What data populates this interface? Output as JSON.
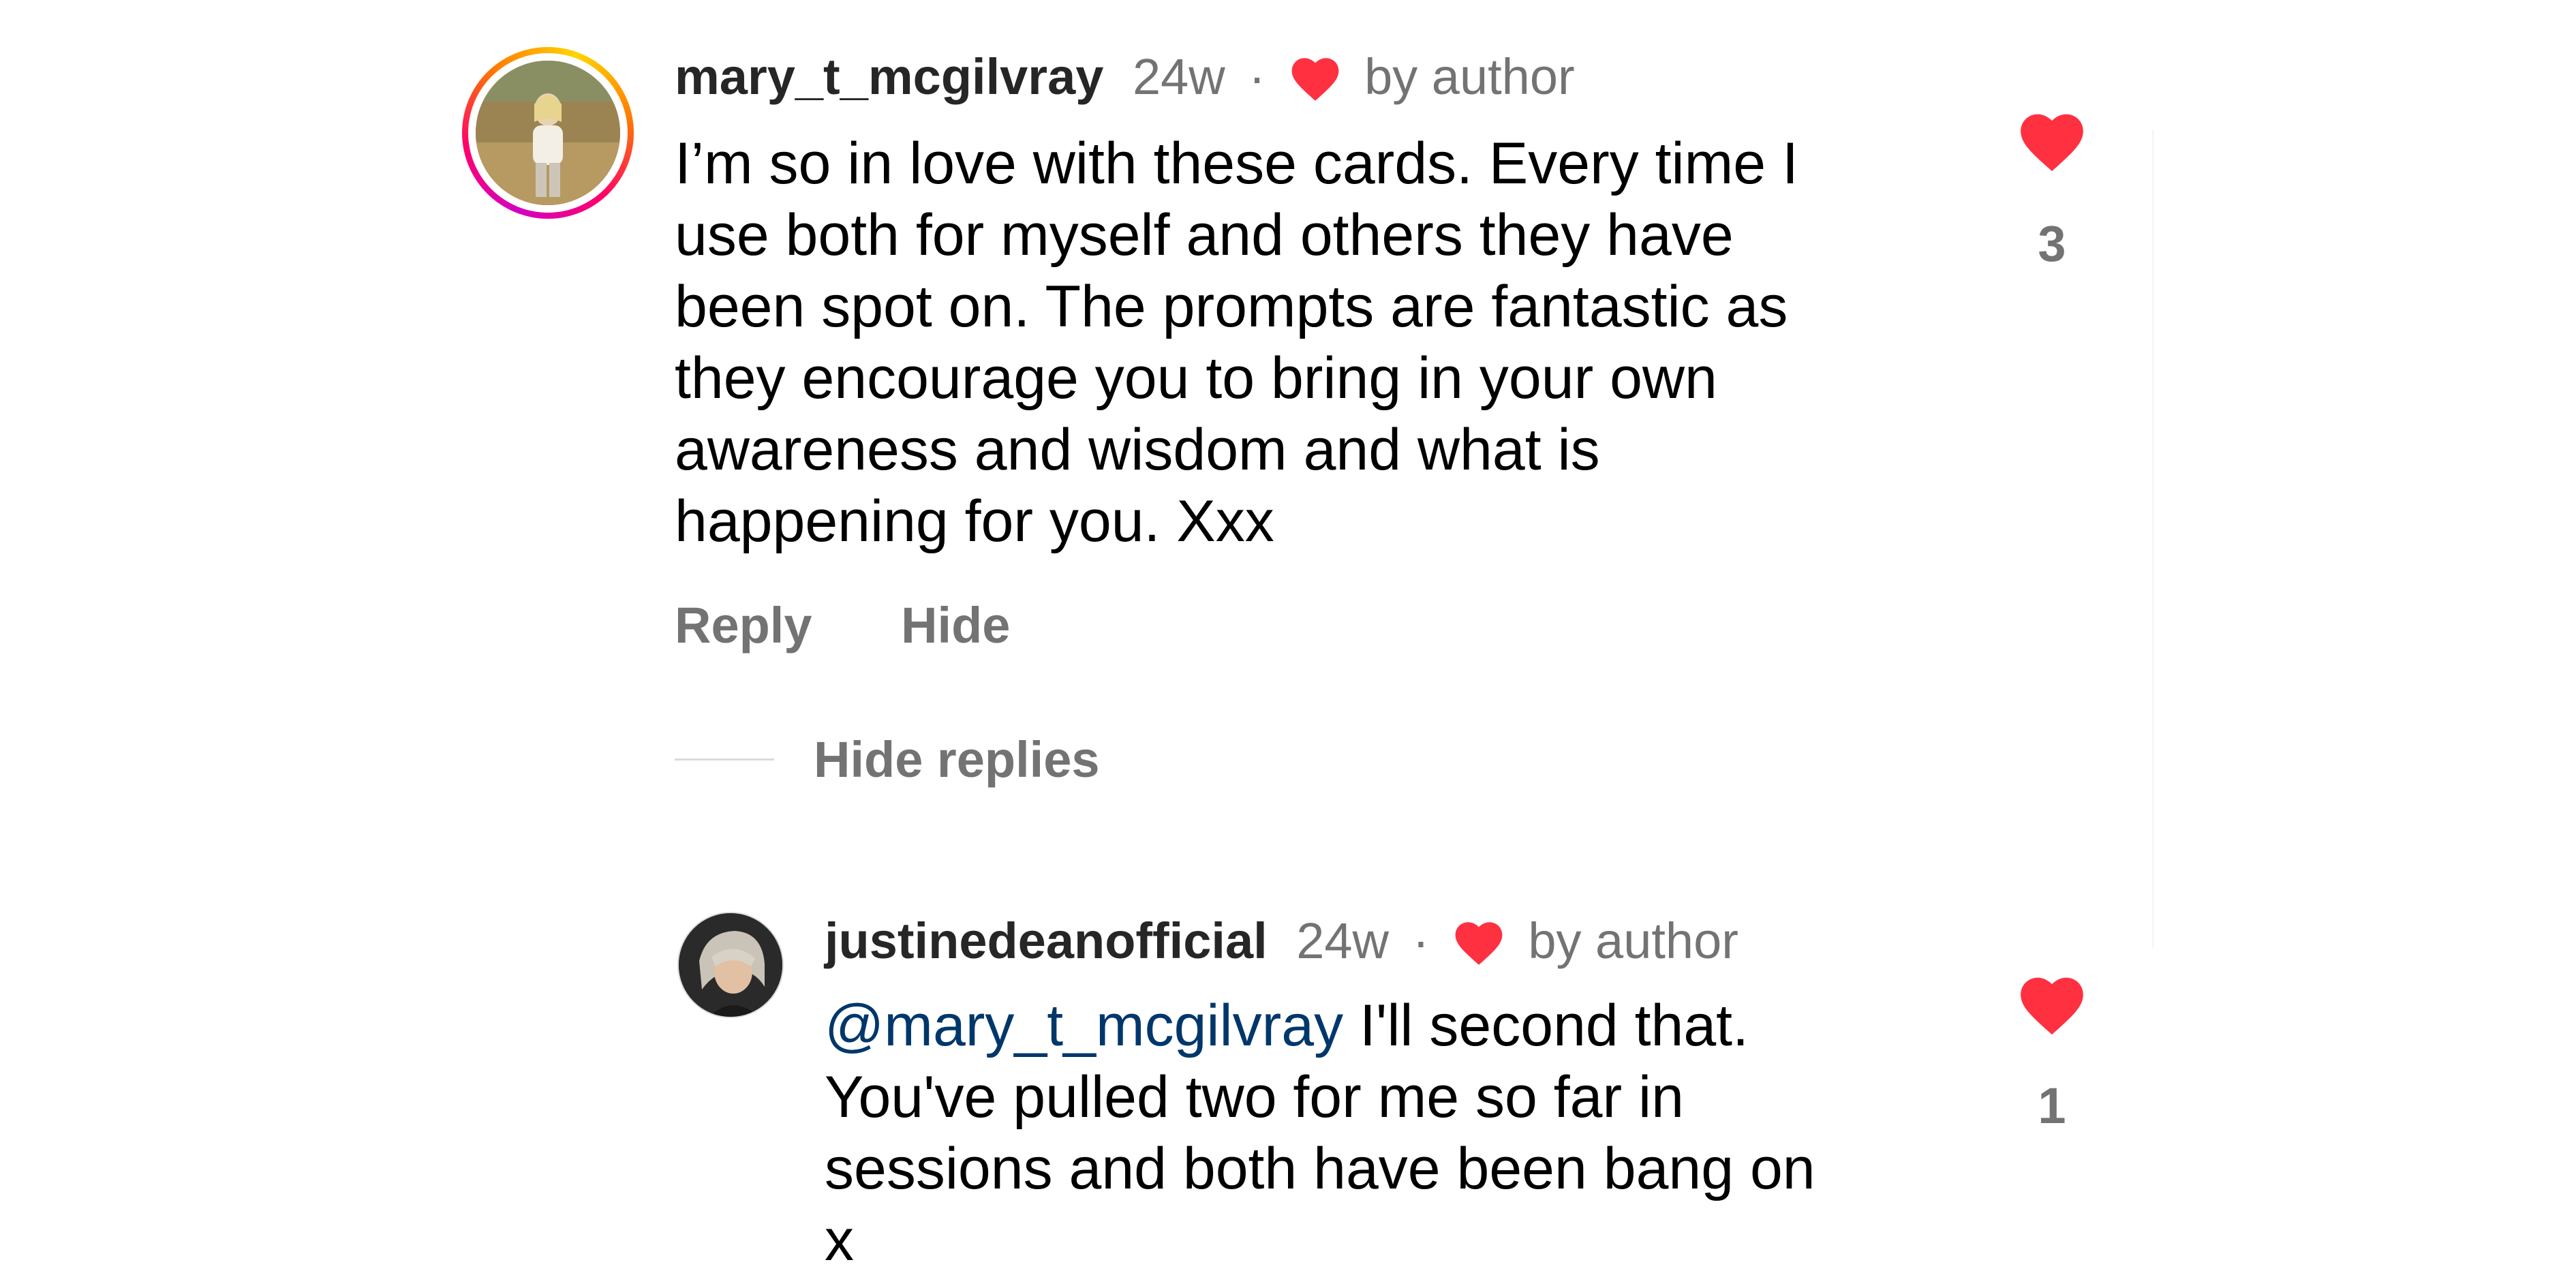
{
  "colors": {
    "heart": "#ff3040",
    "mention": "#00376b",
    "muted": "#737373",
    "username": "#262626"
  },
  "comment": {
    "username": "mary_t_mcgilvray",
    "time": "24w",
    "separator": "·",
    "liked_by": "by author",
    "text_lines": [
      "I’m so in love with these cards. Every time I",
      "use both for myself and others they have",
      "been spot on. The prompts are fantastic as",
      "they encourage you to bring in your own",
      "awareness and wisdom and what is",
      "happening for you. Xxx"
    ],
    "reply_label": "Reply",
    "hide_label": "Hide",
    "likes": "3"
  },
  "thread": {
    "hide_replies_label": "Hide replies"
  },
  "reply": {
    "username": "justinedeanofficial",
    "time": "24w",
    "separator": "·",
    "liked_by": "by author",
    "mention": "@mary_t_mcgilvray",
    "text_first_rest": " I'll second that.",
    "text_lines": [
      "You've pulled two for me so far in",
      "sessions and both have been bang on",
      "x"
    ],
    "likes": "1"
  },
  "icons": {
    "heart": "heart-icon"
  }
}
